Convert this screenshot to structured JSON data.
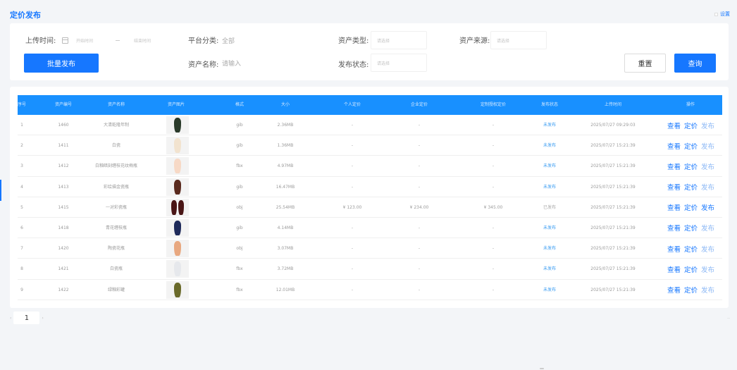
{
  "page_title": "定价发布",
  "top_right_link": "设置",
  "filters": {
    "upload_time_label": "上传时间:",
    "start_placeholder": "开始时间",
    "end_placeholder": "结束时间",
    "platform_label": "平台分类:",
    "platform_value": "全部",
    "asset_type_label": "资产类型:",
    "asset_type_placeholder": "请选择",
    "asset_source_label": "资产来源:",
    "asset_source_placeholder": "请选择",
    "asset_name_label": "资产名称:",
    "asset_name_placeholder": "请输入",
    "publish_status_label": "发布状态:",
    "publish_status_placeholder": "请选择",
    "batch_publish": "批量发布",
    "reset": "重置",
    "query": "查询"
  },
  "table": {
    "columns": [
      "序号",
      "资产编号",
      "资产名称",
      "资产图片",
      "格式",
      "大小",
      "个人定价",
      "企业定价",
      "定制授权定价",
      "发布状态",
      "上传时间",
      "操作"
    ],
    "rows": [
      {
        "index": "1",
        "id": "1460",
        "name": "大清乾隆年制",
        "format": "gib",
        "size": "2.36MB",
        "p1": "-",
        "p2": "-",
        "p3": "-",
        "status": "未发布",
        "time": "2025/07/27 09:29:03",
        "vase": "#2a3a2a",
        "pair": false,
        "published": false
      },
      {
        "index": "2",
        "id": "1411",
        "name": "白瓷",
        "format": "gib",
        "size": "1.36MB",
        "p1": "-",
        "p2": "-",
        "p3": "-",
        "status": "未发布",
        "time": "2025/07/27 15:21:39",
        "vase": "#f2e3cf",
        "pair": false,
        "published": false
      },
      {
        "index": "3",
        "id": "1412",
        "name": "白釉暗刻缠枝花纹梅瓶",
        "format": "fbx",
        "size": "4.97MB",
        "p1": "-",
        "p2": "-",
        "p3": "-",
        "status": "未发布",
        "time": "2025/07/27 15:21:39",
        "vase": "#f7d9c6",
        "pair": false,
        "published": false
      },
      {
        "index": "4",
        "id": "1413",
        "name": "彩绘描金瓷瓶",
        "format": "gib",
        "size": "16.47MB",
        "p1": "-",
        "p2": "-",
        "p3": "-",
        "status": "未发布",
        "time": "2025/07/27 15:21:39",
        "vase": "#5a2a1e",
        "pair": false,
        "published": false
      },
      {
        "index": "5",
        "id": "1415",
        "name": "一对彩瓷瓶",
        "format": "obj",
        "size": "25.54MB",
        "p1": "¥ 123.00",
        "p2": "¥ 234.00",
        "p3": "¥ 345.00",
        "status": "已发布",
        "time": "2025/07/27 15:21:39",
        "vase": "#4a1616",
        "pair": true,
        "published": true
      },
      {
        "index": "6",
        "id": "1418",
        "name": "青花缠枝瓶",
        "format": "gib",
        "size": "4.14MB",
        "p1": "-",
        "p2": "-",
        "p3": "-",
        "status": "未发布",
        "time": "2025/07/27 15:21:39",
        "vase": "#1e2a5a",
        "pair": false,
        "published": false
      },
      {
        "index": "7",
        "id": "1420",
        "name": "陶瓷花瓶",
        "format": "obj",
        "size": "3.07MB",
        "p1": "-",
        "p2": "-",
        "p3": "-",
        "status": "未发布",
        "time": "2025/07/27 15:21:39",
        "vase": "#e8a880",
        "pair": false,
        "published": false
      },
      {
        "index": "8",
        "id": "1421",
        "name": "白瓷瓶",
        "format": "fbx",
        "size": "3.72MB",
        "p1": "-",
        "p2": "-",
        "p3": "-",
        "status": "未发布",
        "time": "2025/07/27 15:21:39",
        "vase": "#e6e8ec",
        "pair": false,
        "published": false
      },
      {
        "index": "9",
        "id": "1422",
        "name": "绿釉彩罐",
        "format": "fbx",
        "size": "12.01MB",
        "p1": "-",
        "p2": "-",
        "p3": "-",
        "status": "未发布",
        "time": "2025/07/27 15:21:39",
        "vase": "#6a6a2a",
        "pair": false,
        "published": false
      }
    ],
    "action_view": "查看",
    "action_price": "定价",
    "action_publish": "发布"
  },
  "pagination": {
    "current": "1",
    "prev": "‹",
    "next": "›",
    "total_text": "··"
  }
}
